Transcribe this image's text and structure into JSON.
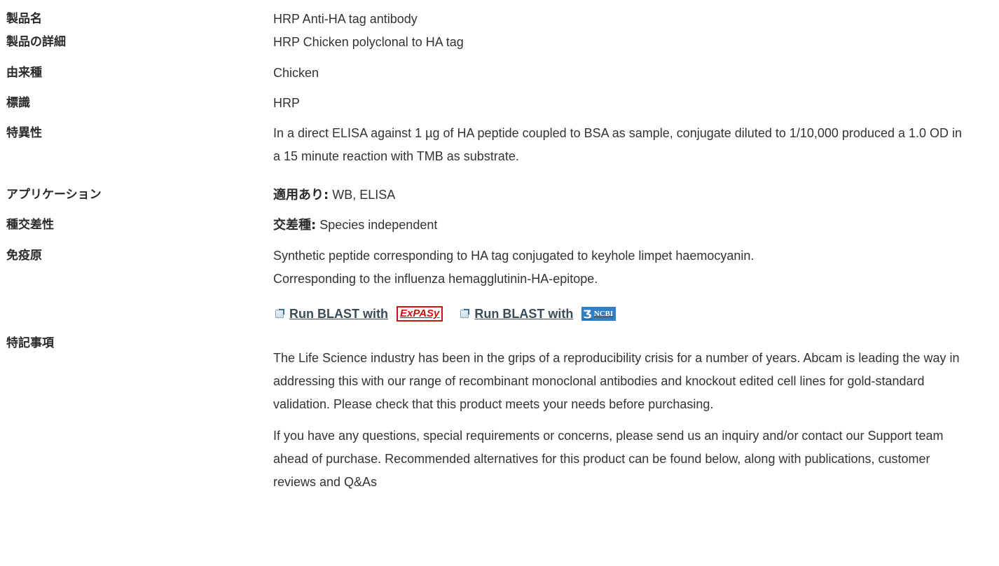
{
  "spec": {
    "product_name": {
      "label": "製品名",
      "value": "HRP Anti-HA tag antibody"
    },
    "product_details": {
      "label": "製品の詳細",
      "value": "HRP Chicken polyclonal to HA tag"
    },
    "host_species": {
      "label": "由来種",
      "value": "Chicken"
    },
    "conjugation": {
      "label": "標識",
      "value": "HRP"
    },
    "specificity": {
      "label": "特異性",
      "value": "In a direct ELISA against 1 µg of HA peptide coupled to BSA as sample, conjugate diluted to 1/10,000 produced a 1.0 OD in a 15 minute reaction with TMB as substrate."
    },
    "applications": {
      "label": "アプリケーション",
      "prefix": "適用あり:",
      "value": "WB, ELISA"
    },
    "reactivity": {
      "label": "種交差性",
      "prefix": "交差種:",
      "value": "Species independent"
    },
    "immunogen": {
      "label": "免疫原",
      "line1": "Synthetic peptide corresponding to HA tag conjugated to keyhole limpet haemocyanin.",
      "line2": "Corresponding to the influenza hemagglutinin-HA-epitope."
    },
    "blast": {
      "expasy_link_label": "Run BLAST with",
      "expasy_logo_text": "ExPASy",
      "ncbi_link_label": "Run BLAST with",
      "ncbi_logo_text": "NCBI"
    },
    "notes": {
      "label": "特記事項",
      "paragraph1": "The Life Science industry has been in the grips of a reproducibility crisis for a number of years. Abcam is leading the way in addressing this with our range of recombinant monoclonal antibodies and knockout edited cell lines for gold-standard validation. Please check that this product meets your needs before purchasing.",
      "paragraph2": "If you have any questions, special requirements or concerns, please send us an inquiry and/or contact our Support team ahead of purchase. Recommended alternatives for this product can be found below, along with publications, customer reviews and Q&As"
    }
  },
  "icons": {
    "external_link": "external-link-icon",
    "ncbi_helix": "helix-icon"
  },
  "colors": {
    "text": "#333333",
    "label": "#2a2a2a",
    "link": "#3b4c59",
    "expasy_red": "#cc1111",
    "ncbi_blue": "#2f80c8"
  }
}
